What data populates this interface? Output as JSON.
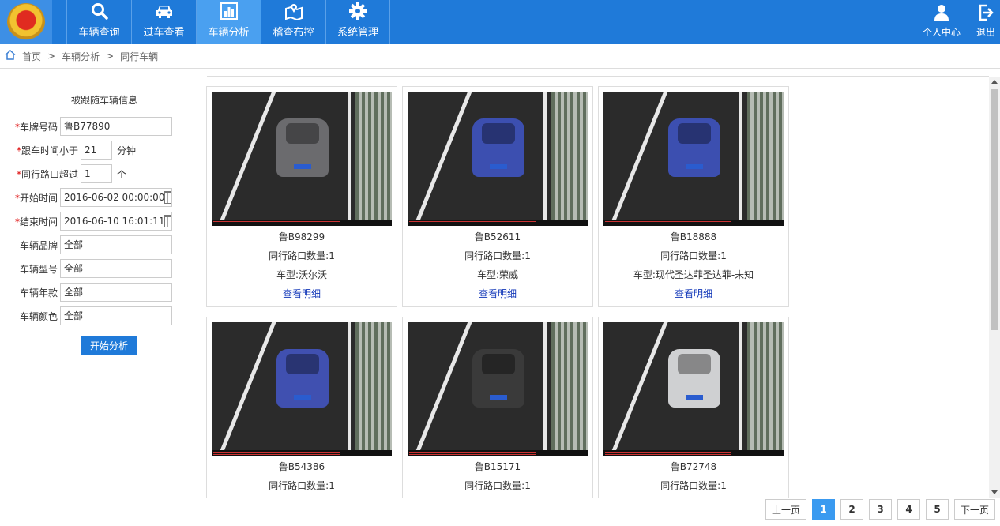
{
  "nav": {
    "items": [
      {
        "label": "车辆查询",
        "icon": "search-icon"
      },
      {
        "label": "过车查看",
        "icon": "car-icon"
      },
      {
        "label": "车辆分析",
        "icon": "bar-chart-icon"
      },
      {
        "label": "稽查布控",
        "icon": "map-pin-icon"
      },
      {
        "label": "系统管理",
        "icon": "gear-icon"
      }
    ],
    "active_index": 2,
    "user_center": "个人中心",
    "logout": "退出"
  },
  "breadcrumb": {
    "home": "首页",
    "sep": ">",
    "level1": "车辆分析",
    "level2": "同行车辆"
  },
  "form": {
    "title": "被跟随车辆信息",
    "required_mark": "*",
    "plate": {
      "label": "车牌号码",
      "value": "鲁B77890"
    },
    "follow_time": {
      "label": "跟车时间小于",
      "value": "21",
      "unit": "分钟"
    },
    "crossings": {
      "label": "同行路口超过",
      "value": "1",
      "unit": "个"
    },
    "start_time": {
      "label": "开始时间",
      "value": "2016-06-02 00:00:00"
    },
    "end_time": {
      "label": "结束时间",
      "value": "2016-06-10 16:01:11"
    },
    "brand": {
      "label": "车辆品牌",
      "value": "全部"
    },
    "model": {
      "label": "车辆型号",
      "value": "全部"
    },
    "year": {
      "label": "车辆年款",
      "value": "全部"
    },
    "color": {
      "label": "车辆颜色",
      "value": "全部"
    },
    "submit": "开始分析"
  },
  "results": [
    {
      "plate": "鲁B98299",
      "count": "同行路口数量:1",
      "type": "车型:沃尔沃",
      "link": "查看明细",
      "car_color": "#6b6b6e"
    },
    {
      "plate": "鲁B52611",
      "count": "同行路口数量:1",
      "type": "车型:荣威",
      "link": "查看明细",
      "car_color": "#3c4fb0"
    },
    {
      "plate": "鲁B18888",
      "count": "同行路口数量:1",
      "type": "车型:现代圣达菲圣达菲-未知",
      "link": "查看明细",
      "car_color": "#3c4fb0"
    },
    {
      "plate": "鲁B54386",
      "count": "同行路口数量:1",
      "car_color": "#4050b0"
    },
    {
      "plate": "鲁B15171",
      "count": "同行路口数量:1",
      "car_color": "#3a3a3a"
    },
    {
      "plate": "鲁B72748",
      "count": "同行路口数量:1",
      "car_color": "#cfd0d2"
    }
  ],
  "pagination": {
    "prev": "上一页",
    "pages": [
      "1",
      "2",
      "3",
      "4",
      "5"
    ],
    "current": "1",
    "next": "下一页"
  }
}
